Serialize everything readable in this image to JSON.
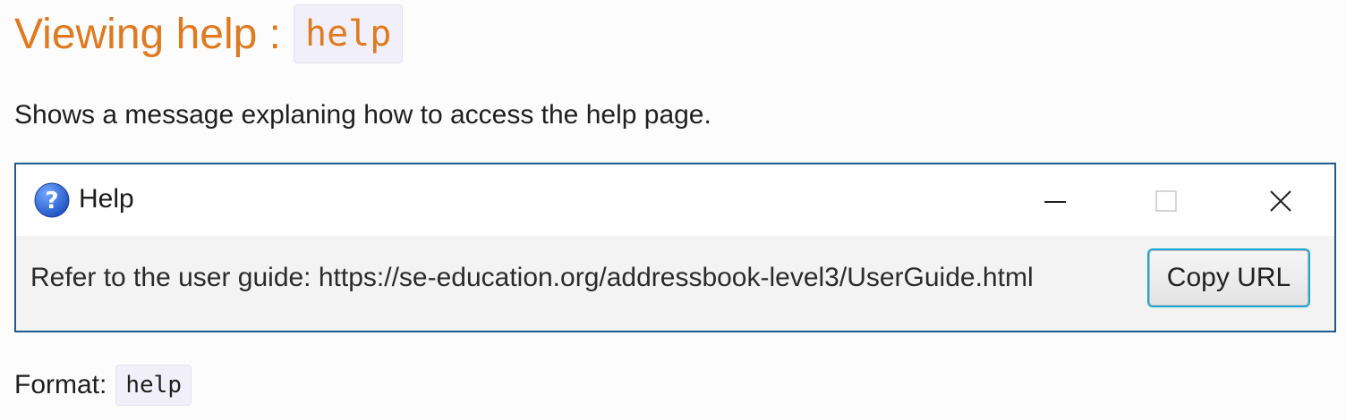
{
  "doc": {
    "heading_text": "Viewing help : ",
    "heading_code": "help",
    "description": "Shows a message explaning how to access the help page.",
    "format_label": "Format:",
    "format_code": "help"
  },
  "help_window": {
    "title": "Help",
    "title_icon": "question-icon",
    "message": "Refer to the user guide: https://se-education.org/addressbook-level3/UserGuide.html",
    "copy_button_label": "Copy URL",
    "window_buttons": [
      "minimize-icon",
      "maximize-icon",
      "close-icon"
    ]
  },
  "colors": {
    "heading": "#e07a1f",
    "window_border": "#1e5a8c",
    "focus_ring": "#1da8d6",
    "code_background": "#f1f0fa",
    "content_background": "#f3f3f3"
  }
}
